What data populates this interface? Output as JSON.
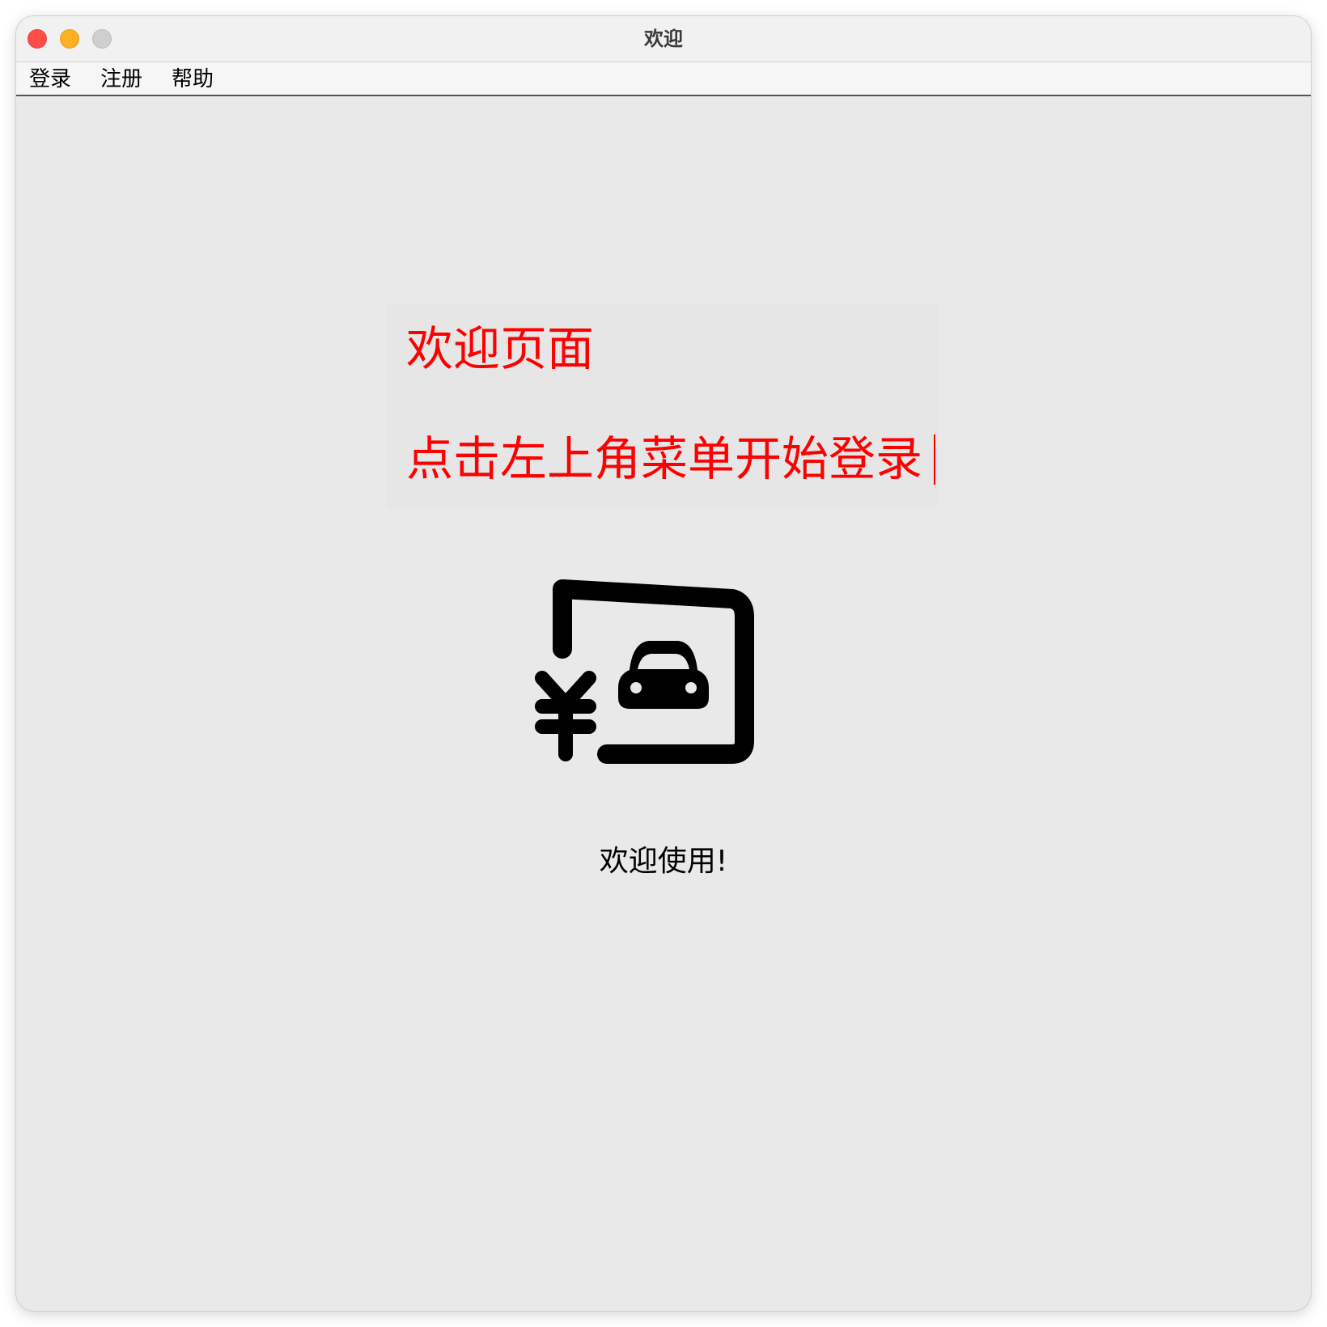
{
  "window": {
    "title": "欢迎"
  },
  "menubar": {
    "items": [
      {
        "label": "登录"
      },
      {
        "label": "注册"
      },
      {
        "label": "帮助"
      }
    ]
  },
  "main": {
    "heading": "欢迎页面",
    "instruction": "点击左上角菜单开始登录",
    "logo_icon": "yen-car-parking-icon",
    "footer": "欢迎使用!"
  },
  "colors": {
    "accent_text": "#ff0000",
    "background": "#e9e9e9"
  }
}
